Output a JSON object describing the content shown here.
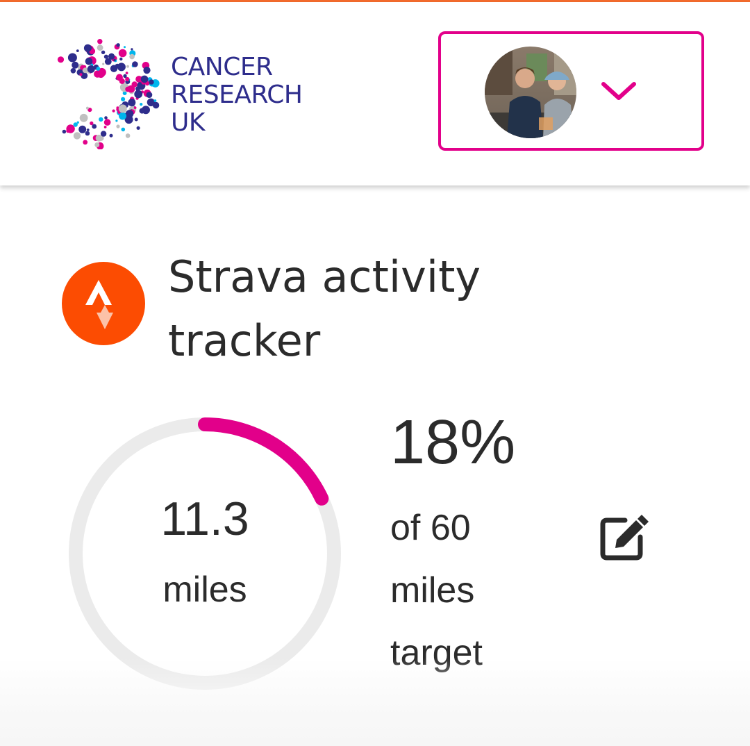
{
  "colors": {
    "brand_navy": "#2e2d8c",
    "brand_pink": "#e2008a",
    "strava_orange": "#fc4c02",
    "top_rule": "#f26b2c",
    "ring_track": "#ebebeb",
    "text": "#2b2b2b"
  },
  "header": {
    "logo": {
      "line1": "CANCER",
      "line2": "RESEARCH",
      "line3": "UK"
    },
    "account_menu": {
      "avatar_icon": "user-photo",
      "chevron_icon": "chevron-down-icon"
    }
  },
  "tracker": {
    "logo_icon": "strava-icon",
    "title": "Strava activity tracker",
    "distance_value": "11.3",
    "distance_unit": "miles",
    "percent_label": "18%",
    "progress_fraction": 0.18,
    "target_line1": "of 60",
    "target_line2": "miles",
    "target_line3": "target",
    "edit_icon": "edit-icon"
  }
}
